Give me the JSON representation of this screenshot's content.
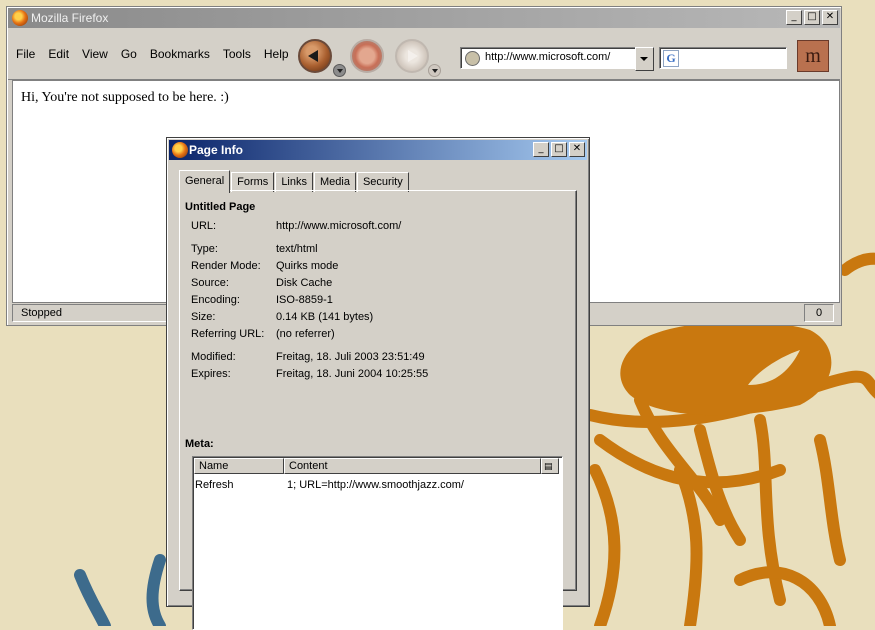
{
  "browser": {
    "title": "Mozilla Firefox",
    "menu": [
      "File",
      "Edit",
      "View",
      "Go",
      "Bookmarks",
      "Tools",
      "Help"
    ],
    "url": "http://www.microsoft.com/",
    "search_engine_icon": "G",
    "page_text": "Hi, You're not supposed to be here. :)",
    "status": "Stopped",
    "status_count": "0"
  },
  "dialog": {
    "title": "Page Info",
    "tabs": [
      "General",
      "Forms",
      "Links",
      "Media",
      "Security"
    ],
    "active_tab": "General",
    "page_title": "Untitled Page",
    "rows": [
      {
        "label": "URL:",
        "value": "http://www.microsoft.com/"
      },
      {
        "label": "Type:",
        "value": "text/html"
      },
      {
        "label": "Render Mode:",
        "value": "Quirks mode"
      },
      {
        "label": "Source:",
        "value": "Disk Cache"
      },
      {
        "label": "Encoding:",
        "value": "ISO-8859-1"
      },
      {
        "label": "Size:",
        "value": "0.14 KB (141 bytes)"
      },
      {
        "label": "Referring URL:",
        "value": "(no referrer)"
      },
      {
        "label": "Modified:",
        "value": "Freitag, 18. Juli 2003 23:51:49"
      },
      {
        "label": "Expires:",
        "value": "Freitag, 18. Juni 2004 10:25:55"
      }
    ],
    "meta_label": "Meta:",
    "meta_columns": [
      "Name",
      "Content"
    ],
    "meta_rows": [
      {
        "name": "Refresh",
        "content": "1; URL=http://www.smoothjazz.com/"
      }
    ]
  },
  "window_controls": {
    "minimize": "_",
    "maximize": "□",
    "close": "✕"
  },
  "colors": {
    "desktop_bg": "#e9dfbd",
    "desktop_art_orange": "#c9780f",
    "desktop_art_blue": "#3d6b8c",
    "dialog_title_bg": "#0a246a",
    "inactive_title_bg": "#8a8a8a"
  }
}
